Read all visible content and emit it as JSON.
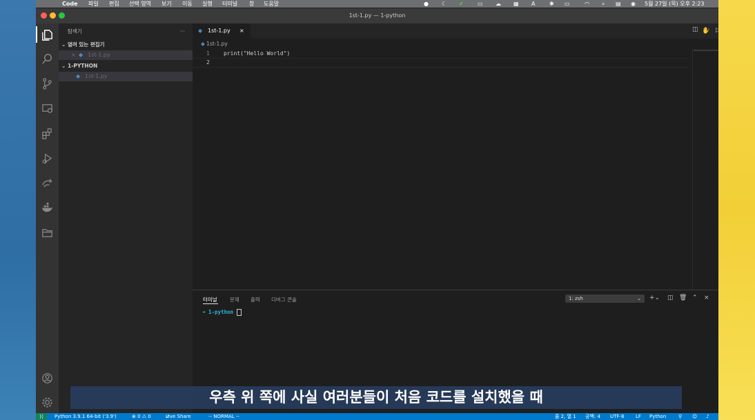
{
  "menubar": {
    "app": "Code",
    "items": [
      "파일",
      "편집",
      "선택 영역",
      "보기",
      "이동",
      "실행",
      "터미널",
      "창",
      "도움말"
    ],
    "clock": "5월 27일 (목) 오후 2:23"
  },
  "window": {
    "title": "1st-1.py — 1-python"
  },
  "sidebar": {
    "header": "탐색기",
    "more": "···",
    "open_editors": {
      "title": "열려 있는 편집기",
      "files": [
        "1st-1.py"
      ]
    },
    "folder": {
      "title": "1-PYTHON",
      "files": [
        "1st-1.py"
      ]
    }
  },
  "editor": {
    "tab": "1st-1.py",
    "breadcrumb": "1st-1.py",
    "lines": [
      {
        "num": "1",
        "text": "print(\"Hello World\")"
      },
      {
        "num": "2",
        "text": ""
      }
    ]
  },
  "panel": {
    "tabs": [
      "터미널",
      "문제",
      "출력",
      "디버그 콘솔"
    ],
    "terminal_select": "1: zsh",
    "prompt_arrow": "➜",
    "prompt_dir": "1-python"
  },
  "statusbar": {
    "python": "Python 3.9.1 64-bit ('3.9')",
    "problems": "⊗ 0 ⚠ 0",
    "liveshare": "Live Share",
    "mode": "-- NORMAL --",
    "position": "줄 2, 열 1",
    "spaces": "공백: 4",
    "encoding": "UTF-8",
    "eol": "LF",
    "language": "Python"
  },
  "subtitle": "우측 위 쪽에 사실 여러분들이 처음 코드를 설치했을 때",
  "colors": {
    "status": "#007acc",
    "accent_folder": "#4fc1ff"
  }
}
